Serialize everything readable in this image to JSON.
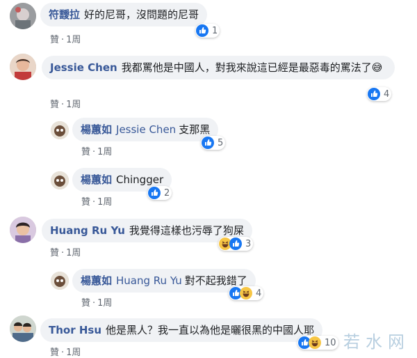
{
  "colors": {
    "author": "#385898",
    "bubble": "#f0f2f5",
    "like_blue": "#1877f2",
    "haha_yellow": "#f7c645"
  },
  "icons": {
    "like": "like-reaction-icon",
    "haha": "haha-reaction-icon"
  },
  "comments": [
    {
      "author": "符靉拉",
      "text": "好的尼哥，沒問題的尼哥",
      "like_label": "贊",
      "time": "1周",
      "reactions": [
        "like"
      ],
      "reaction_count": "1"
    },
    {
      "author": "Jessie Chen",
      "text": "我都罵他是中國人，對我來說這已經是最惡毒的罵法了😅",
      "like_label": "贊",
      "time": "1周",
      "reactions": [
        "like"
      ],
      "reaction_count": "4"
    },
    {
      "author": "楊蕙如",
      "mention": "Jessie Chen",
      "text": "支那黑",
      "like_label": "贊",
      "time": "1周",
      "reactions": [
        "like"
      ],
      "reaction_count": "5"
    },
    {
      "author": "楊蕙如",
      "text": "Chingger",
      "like_label": "贊",
      "time": "1周",
      "reactions": [
        "like"
      ],
      "reaction_count": "2"
    },
    {
      "author": "Huang Ru Yu",
      "text": "我覺得這樣也污辱了狗屎",
      "like_label": "贊",
      "time": "1周",
      "reactions": [
        "haha",
        "like"
      ],
      "reaction_count": "3"
    },
    {
      "author": "楊蕙如",
      "mention": "Huang Ru Yu",
      "text": "對不起我錯了",
      "like_label": "贊",
      "time": "1周",
      "reactions": [
        "like",
        "haha"
      ],
      "reaction_count": "4"
    },
    {
      "author": "Thor Hsu",
      "text": "他是黑人？我一直以為他是曬很黑的中國人耶",
      "like_label": "贊",
      "time": "1周",
      "reactions": [
        "like",
        "haha"
      ],
      "reaction_count": "10"
    }
  ],
  "separator": "·",
  "watermark": "若水网"
}
